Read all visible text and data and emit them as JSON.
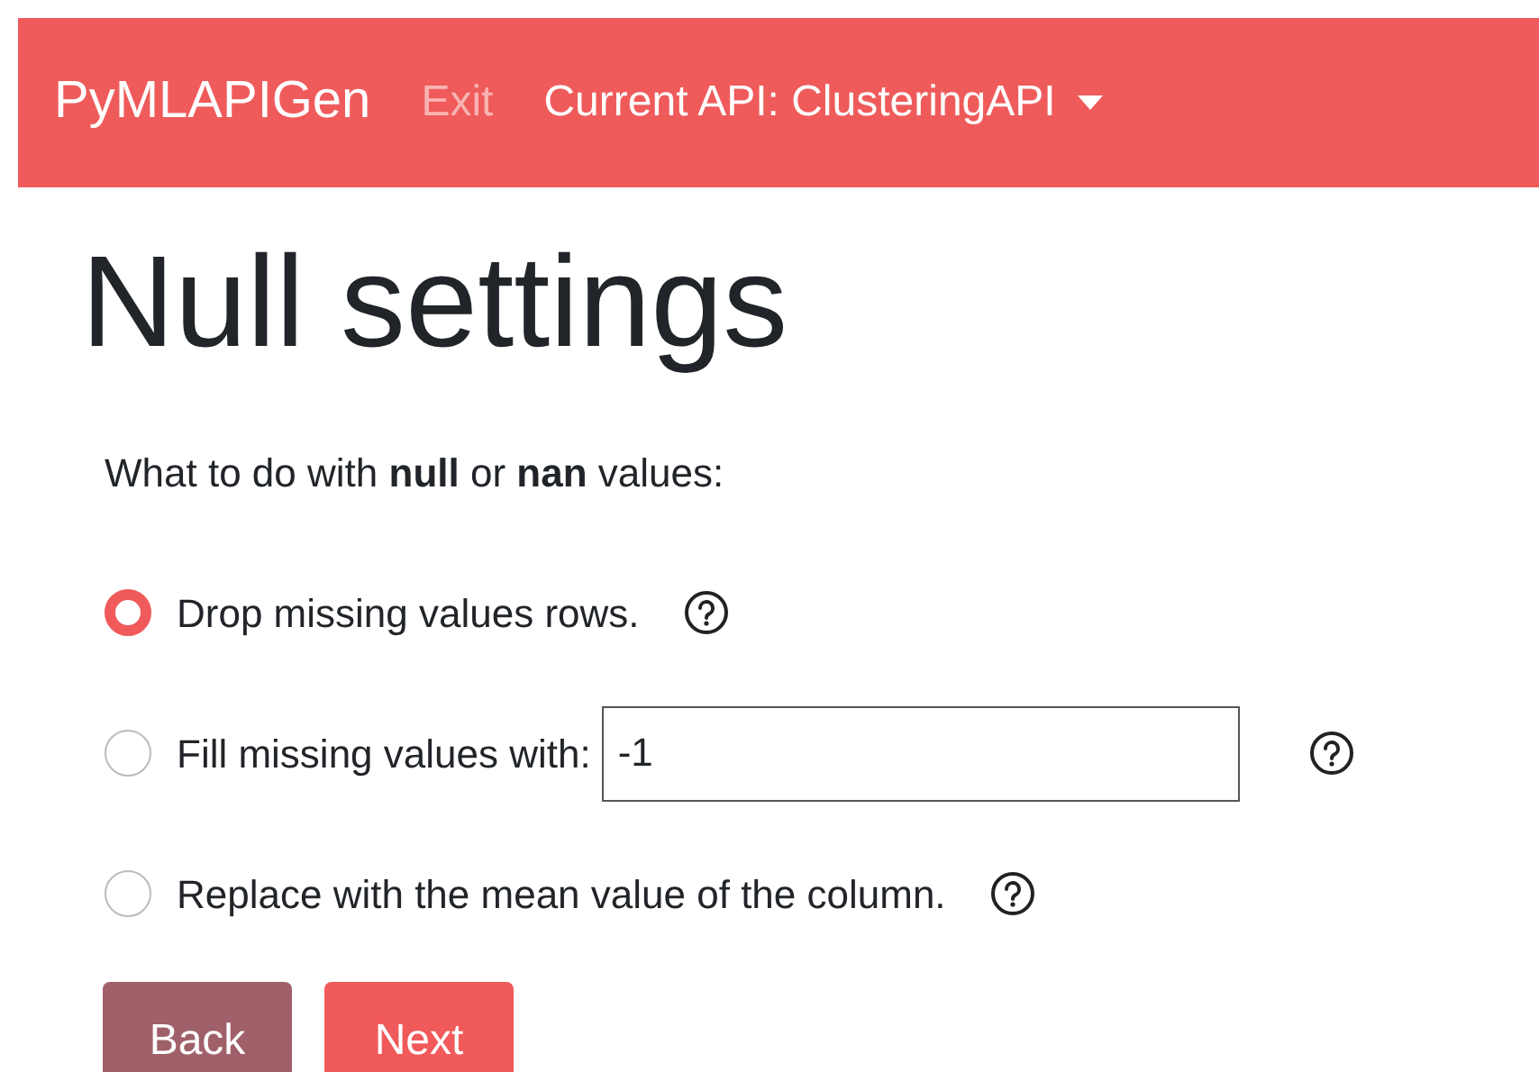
{
  "navbar": {
    "brand": "PyMLAPIGen",
    "links": [
      {
        "label": "Exit",
        "disabled": true,
        "dropdown": false
      },
      {
        "label": "Current API: ClusteringAPI",
        "dropdown": true,
        "disabled": false
      }
    ]
  },
  "title": "Null settings",
  "prompt": "What to do with **null** or **nan** values:",
  "options": [
    {
      "label": "Drop missing values rows.",
      "selected": true,
      "kind": "plain"
    },
    {
      "label": "Fill missing values with:",
      "selected": false,
      "kind": "input",
      "value": "-1"
    },
    {
      "label": "Replace with the mean value of the column.",
      "selected": false,
      "kind": "plain"
    }
  ],
  "buttons": [
    {
      "label": "Back",
      "kind": "secondary"
    },
    {
      "label": "Next",
      "kind": "primary"
    }
  ]
}
